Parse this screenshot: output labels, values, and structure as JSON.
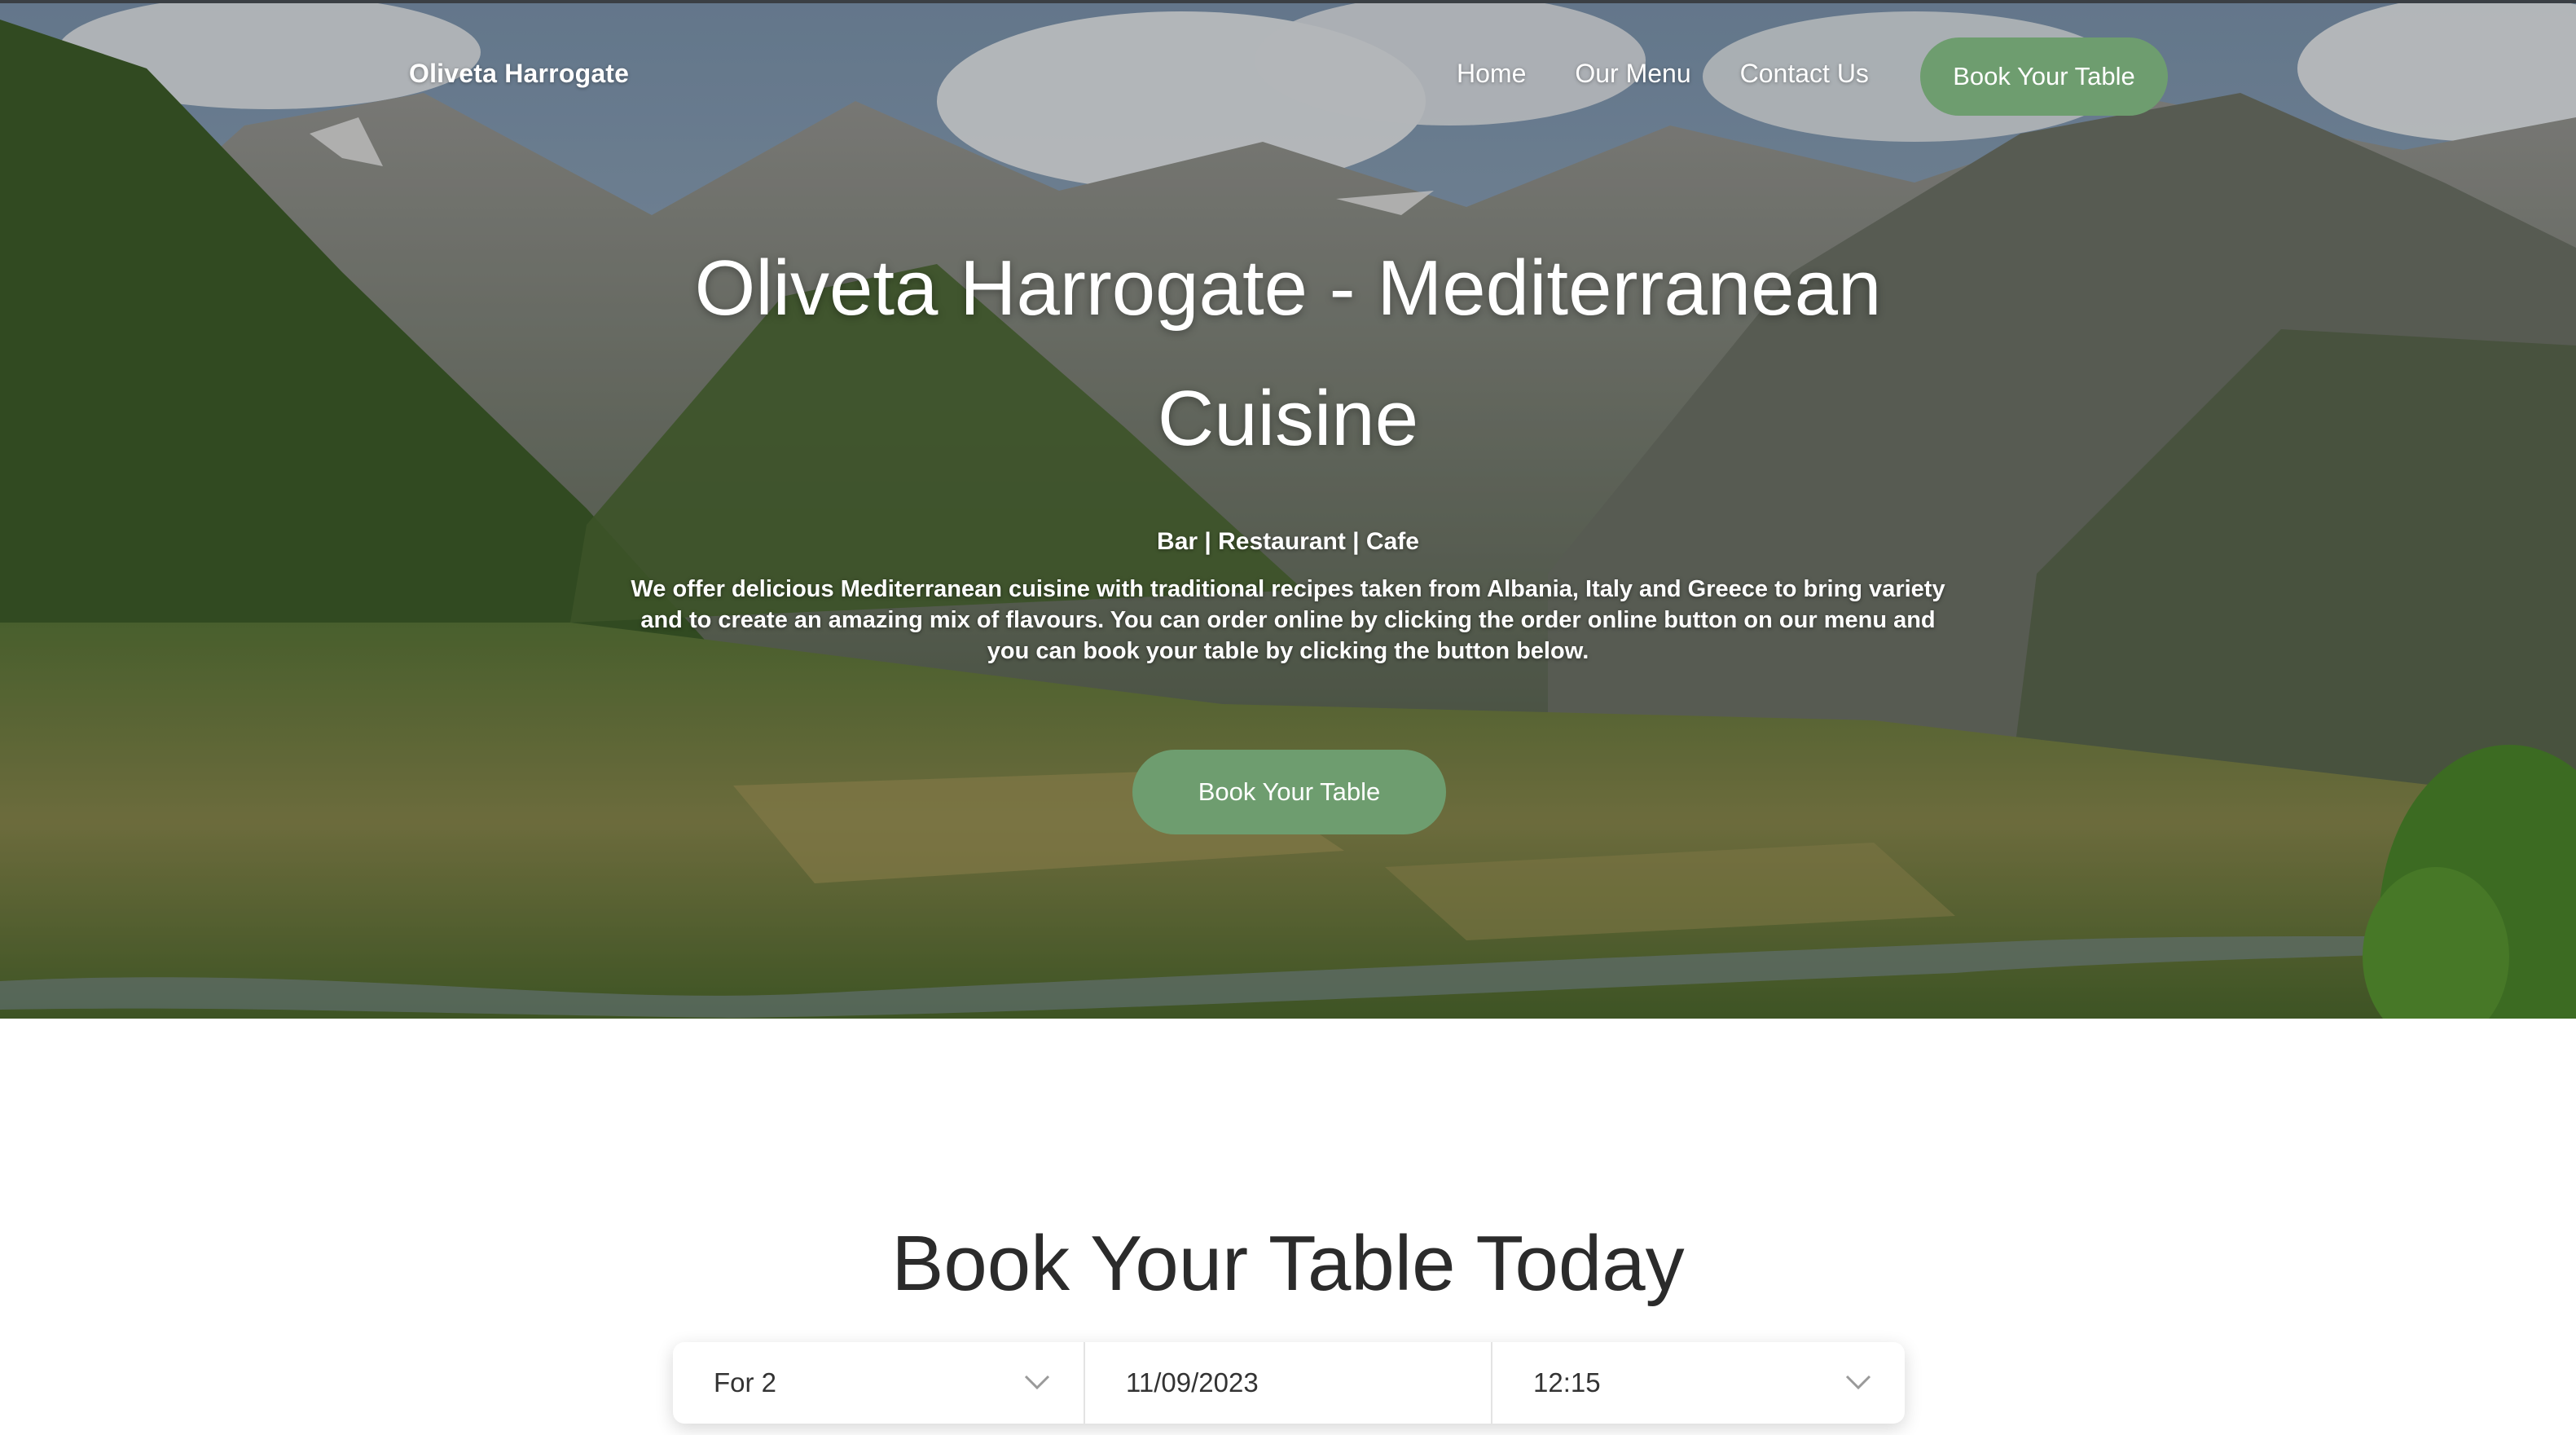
{
  "nav": {
    "brand": "Oliveta Harrogate",
    "links": [
      "Home",
      "Our Menu",
      "Contact Us"
    ],
    "cta_label": "Book Your Table"
  },
  "hero": {
    "title": "Oliveta Harrogate - Mediterranean Cuisine",
    "tagline": "Bar | Restaurant | Cafe",
    "description": "We offer delicious Mediterranean cuisine with traditional recipes taken from Albania, Italy and Greece to bring variety and to create an amazing mix of flavours. You can order online by clicking the order online button on our menu and you can book your table by clicking the button below.",
    "cta_label": "Book Your Table",
    "background": "mountain-valley-landscape-photo"
  },
  "booking": {
    "title": "Book Your Table Today",
    "party_size": "For 2",
    "date": "11/09/2023",
    "time": "12:15"
  },
  "colors": {
    "accent": "#6e9d6f",
    "text_dark": "#2b2b2b",
    "white": "#ffffff"
  },
  "icons": {
    "party_chevron": "chevron-down-icon",
    "time_chevron": "chevron-down-icon"
  }
}
